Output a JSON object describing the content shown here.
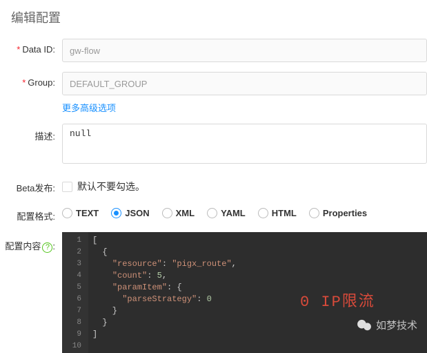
{
  "page": {
    "title": "编辑配置"
  },
  "form": {
    "dataId": {
      "label": "Data ID:",
      "value": "gw-flow"
    },
    "group": {
      "label": "Group:",
      "value": "DEFAULT_GROUP"
    },
    "moreLink": "更多高级选项",
    "desc": {
      "label": "描述:",
      "value": "null"
    },
    "beta": {
      "label": "Beta发布:",
      "hint": "默认不要勾选。"
    },
    "format": {
      "label": "配置格式:",
      "options": [
        "TEXT",
        "JSON",
        "XML",
        "YAML",
        "HTML",
        "Properties"
      ],
      "selected": "JSON"
    },
    "content": {
      "label": "配置内容",
      "help": "?"
    }
  },
  "editor": {
    "lines": [
      1,
      2,
      3,
      4,
      5,
      6,
      7,
      8,
      9,
      10
    ],
    "code": {
      "l1": "[",
      "l2": "  {",
      "l3a": "    ",
      "l3k": "\"resource\"",
      "l3c": ": ",
      "l3v": "\"pigx_route\"",
      "l3e": ",",
      "l4a": "    ",
      "l4k": "\"count\"",
      "l4c": ": ",
      "l4v": "5",
      "l4e": ",",
      "l5a": "    ",
      "l5k": "\"paramItem\"",
      "l5c": ": {",
      "l6a": "      ",
      "l6k": "\"parseStrategy\"",
      "l6c": ": ",
      "l6v": "0",
      "l7": "    }",
      "l8": "  }",
      "l9": "]"
    },
    "annotation": "0  IP限流"
  },
  "watermark": "如梦技术"
}
